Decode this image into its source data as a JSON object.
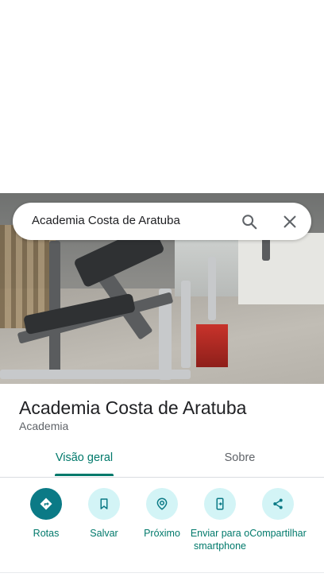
{
  "search": {
    "query": "Academia Costa de Aratuba"
  },
  "place": {
    "name": "Academia Costa de Aratuba",
    "category": "Academia"
  },
  "tabs": [
    {
      "label": "Visão geral",
      "selected": true
    },
    {
      "label": "Sobre",
      "selected": false
    }
  ],
  "actions": [
    {
      "label": "Rotas",
      "icon": "directions-icon"
    },
    {
      "label": "Salvar",
      "icon": "bookmark-icon"
    },
    {
      "label": "Próximo",
      "icon": "nearby-icon"
    },
    {
      "label": "Enviar para o smartphone",
      "icon": "send-to-phone-icon"
    },
    {
      "label": "Compartilhar",
      "icon": "share-icon"
    }
  ],
  "colors": {
    "accent": "#00796b",
    "primary_button": "#0b7a86",
    "action_bg": "#d3f4f6"
  }
}
